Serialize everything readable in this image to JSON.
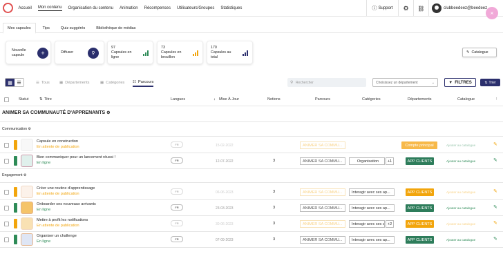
{
  "nav": {
    "items": [
      "Accueil",
      "Mon contenu",
      "Organisation du contenu",
      "Animation",
      "Récompenses",
      "Utilisateurs/Groupes",
      "Statistiques"
    ],
    "support": "Support",
    "user": "clubbeedeez@beedeez",
    "close": "×"
  },
  "tabs": [
    "Mes capsules",
    "Tips",
    "Quiz suggérés",
    "Bibliothèque de médias"
  ],
  "cards": {
    "new": "Nouvelle capsule",
    "diffuse": "Diffuser",
    "online_count": "97",
    "online_label": "Capsules en ligne",
    "draft_count": "73",
    "draft_label": "Capsules en brouillon",
    "total_count": "170",
    "total_label": "Capsules au total"
  },
  "catalogue_button": "Catalogue",
  "filters": {
    "tabs": [
      "Tous",
      "Départements",
      "Catégories",
      "Parcours"
    ],
    "search_placeholder": "Rechercher",
    "dept_placeholder": "Choisissez un département",
    "filtres": "FILTRES",
    "trier": "Trier"
  },
  "headers": {
    "statut": "Statut",
    "titre": "Titre",
    "langues": "Langues",
    "date": "Mise À Jour",
    "notions": "Notions",
    "parcours": "Parcours",
    "categories": "Catégories",
    "departements": "Départements",
    "catalogue": "Catalogue"
  },
  "section": {
    "title": "ANIMER SA COMMUNAUTÉ D'APPRENANTS",
    "sub1": "Communication",
    "sub2": "Engagement"
  },
  "rows": [
    {
      "title": "Capsule en construction",
      "status": "En attente de publication",
      "lang": "FR",
      "date": "15-02-2022",
      "notions": "",
      "parcours": "ANIMER SA COMMU...",
      "categorie": "",
      "plus": "",
      "dept": "Compte principal",
      "catalogue": "Ajouter au catalogue"
    },
    {
      "title": "Bien communiquer pour un lancement réussi !",
      "status": "En ligne",
      "lang": "FR",
      "date": "12-07-2022",
      "notions": "3",
      "parcours": "ANIMER SA COMMU...",
      "categorie": "Organisation",
      "plus": "+1",
      "dept": "APP CLIENTS",
      "catalogue": "Ajouter au catalogue"
    },
    {
      "title": "Créer une routine d'apprentissage",
      "status": "En attente de publication",
      "lang": "FR",
      "date": "06-06-2023",
      "notions": "3",
      "parcours": "ANIMER SA COMMU...",
      "categorie": "Interagir avec ses ap...",
      "plus": "",
      "dept": "APP CLIENTS",
      "catalogue": "Ajouter au catalogue"
    },
    {
      "title": "Onboarder ses nouveaux arrivants",
      "status": "En ligne",
      "lang": "FR",
      "date": "23-03-2023",
      "notions": "3",
      "parcours": "ANIMER SA COMMU...",
      "categorie": "Interagir avec ses ap...",
      "plus": "",
      "dept": "APP CLIENTS",
      "catalogue": "Ajouter au catalogue"
    },
    {
      "title": "Mettre à profit les notifications",
      "status": "En attente de publication",
      "lang": "FR",
      "date": "30-06-2023",
      "notions": "3",
      "parcours": "ANIMER SA COMMU...",
      "categorie": "Interagir avec ses ap...",
      "plus": "+2",
      "dept": "APP CLIENTS",
      "catalogue": "Ajouter au catalogue"
    },
    {
      "title": "Organiser un challenge",
      "status": "En ligne",
      "lang": "FR",
      "date": "07-09-2023",
      "notions": "3",
      "parcours": "ANIMER SA COMMU...",
      "categorie": "Interagir avec ses ap...",
      "plus": "",
      "dept": "APP CLIENTS",
      "catalogue": "Ajouter au catalogue"
    }
  ],
  "colors": {
    "primary": "#2b2f6d",
    "orange": "#f2a50c",
    "green": "#2e8b57"
  }
}
